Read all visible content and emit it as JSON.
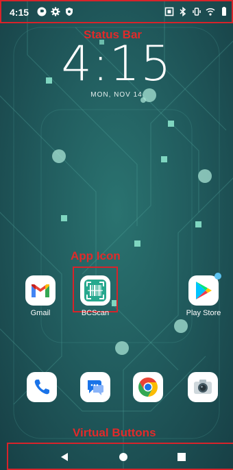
{
  "status_bar": {
    "time": "4:15",
    "left_icons": [
      "privacy-icon",
      "gear-icon",
      "shield-icon"
    ],
    "right_icons": [
      "nfc-icon",
      "bluetooth-icon",
      "vibrate-icon",
      "wifi-icon",
      "battery-icon"
    ]
  },
  "lockscreen": {
    "clock": "4:15",
    "date": "MON, NOV 14"
  },
  "annotations": {
    "status_bar": "Status Bar",
    "app_icon": "App Icon",
    "virtual_buttons": "Virtual Buttons"
  },
  "apps": [
    {
      "name": "gmail",
      "label": "Gmail"
    },
    {
      "name": "bcscan",
      "label": "BCScan"
    },
    {
      "name": "play-store",
      "label": "Play Store"
    }
  ],
  "dock": [
    "phone-icon",
    "messages-icon",
    "chrome-icon",
    "camera-icon"
  ],
  "nav_buttons": [
    "back-icon",
    "home-icon",
    "recents-icon"
  ],
  "colors": {
    "annotation": "#d8232a",
    "wallpaper": "#215c5e",
    "accent_dot": "#7fd6c0"
  }
}
